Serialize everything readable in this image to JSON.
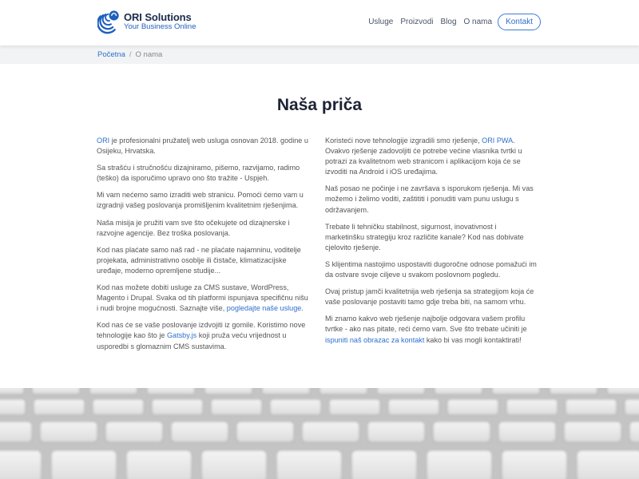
{
  "header": {
    "brand_name": "ORI Solutions",
    "brand_tagline": "Your Business Online",
    "nav": [
      "Usluge",
      "Proizvodi",
      "Blog",
      "O nama"
    ],
    "contact_label": "Kontakt"
  },
  "breadcrumb": {
    "home": "Početna",
    "separator": "/",
    "current": "O nama"
  },
  "main": {
    "title": "Naša priča",
    "left": {
      "p1_link": "ORI",
      "p1_text": " je profesionalni pružatelj web usluga osnovan 2018. godine u Osijeku, Hrvatska.",
      "p2": "Sa strašću i stručnošću dizajniramo, pišemo, razvijamo, radimo (teško) da isporučimo upravo ono što tražite - Uspjeh.",
      "p3": "Mi vam nećemo samo izraditi web stranicu. Pomoći ćemo vam u izgradnji vašeg poslovanja promišljenim kvalitetnim rješenjima.",
      "p4": "Naša misija je pružiti vam sve što očekujete od dizajnerske i razvojne agencije. Bez troška poslovanja.",
      "p5": "Kod nas plaćate samo naš rad - ne plaćate najamninu, voditelje projekata, administrativno osoblje ili čistače, klimatizacijske uređaje, moderno opremljene studije...",
      "p6_text": "Kod nas možete dobiti usluge za CMS sustave, WordPress, Magento i Drupal. Svaka od tih platformi ispunjava specifičnu nišu i nudi brojne mogućnosti. Saznajte više, ",
      "p6_link": "pogledajte naše usluge",
      "p6_end": ".",
      "p7_text": "Kod nas će se vaše poslovanje izdvojiti iz gomile. Koristimo nove tehnologije kao što je ",
      "p7_link": "Gatsby.js",
      "p7_end": " koji pruža veću vrijednost u usporedbi s glomaznim CMS sustavima."
    },
    "right": {
      "p1_text": "Koristeći nove tehnologije izgradili smo rješenje, ",
      "p1_link": "ORI PWA",
      "p1_end": ". Ovakvo rješenje zadovoljiti će potrebe većine vlasnika tvrtki u potrazi za kvalitetnom web stranicom i aplikacijom koja će se izvoditi na Android i iOS uređajima.",
      "p2": "Naš posao ne počinje i ne završava s isporukom rješenja. Mi vas možemo i želimo voditi, zaštititi i ponuditi vam punu uslugu s održavanjem.",
      "p3": "Trebate li tehničku stabilnost, sigurnost, inovativnost i marketinšku strategiju kroz različite kanale? Kod nas dobivate cjelovito rješenje.",
      "p4": "S klijentima nastojimo uspostaviti dugoročne odnose pomažući im da ostvare svoje ciljeve u svakom poslovnom pogledu.",
      "p5": "Ovaj pristup jamči kvalitetnija web rješenja sa strategijom koja će vaše poslovanje postaviti tamo gdje treba biti, na samom vrhu.",
      "p6_text": "Mi znamo kakvo web rješenje najbolje odgovara vašem profilu tvrtke - ako nas pitate, reći ćemo vam. Sve što trebate učiniti je ",
      "p6_link": "ispuniti naš obrazac za kontakt",
      "p6_end": " kako bi vas mogli kontaktirati!"
    }
  },
  "colors": {
    "accent": "#2f6fcc",
    "brand_dark": "#1a2b4c",
    "breadcrumb_bg": "#f1f3f5"
  },
  "icons": {
    "logo": "ori-spiral-logo-icon"
  }
}
